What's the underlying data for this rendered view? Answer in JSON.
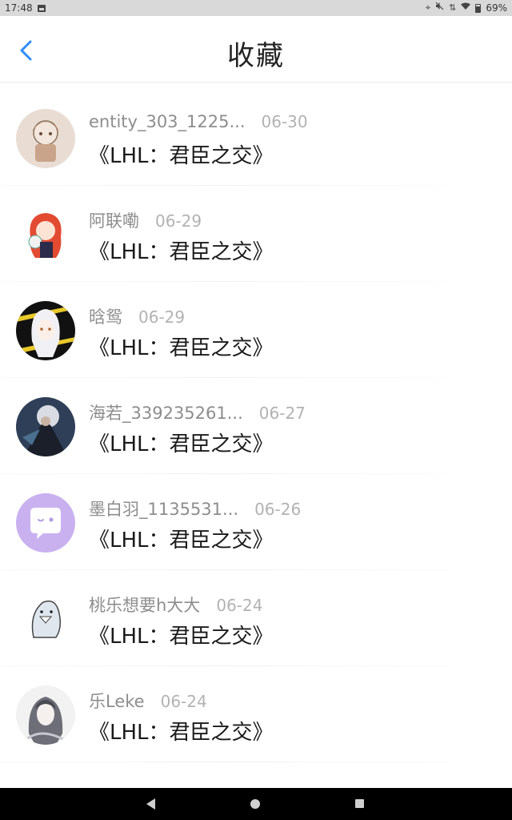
{
  "status_bar": {
    "time": "17:48",
    "battery": "69%",
    "icons": [
      "image-icon",
      "location-icon",
      "mute-icon",
      "data-arrows-icon",
      "wifi-icon",
      "battery-icon"
    ]
  },
  "header": {
    "title": "收藏",
    "back_icon": "chevron-left-icon",
    "accent_color": "#2f8cff"
  },
  "favorites": [
    {
      "username": "entity_303_1225...",
      "date": "06-30",
      "title": "《LHL：君臣之交》"
    },
    {
      "username": "阿联嘞",
      "date": "06-29",
      "title": "《LHL：君臣之交》"
    },
    {
      "username": "晗鸳",
      "date": "06-29",
      "title": "《LHL：君臣之交》"
    },
    {
      "username": "海若_339235261...",
      "date": "06-27",
      "title": "《LHL：君臣之交》"
    },
    {
      "username": "墨白羽_1135531...",
      "date": "06-26",
      "title": "《LHL：君臣之交》"
    },
    {
      "username": "桃乐想要h大大",
      "date": "06-24",
      "title": "《LHL：君臣之交》"
    },
    {
      "username": "乐Leke",
      "date": "06-24",
      "title": "《LHL：君臣之交》"
    }
  ],
  "navigation_bar": {
    "buttons": [
      "back-triangle-icon",
      "home-circle-icon",
      "recents-square-icon"
    ]
  }
}
